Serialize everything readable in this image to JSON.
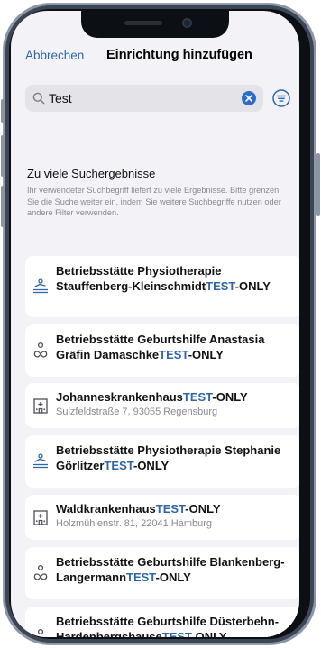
{
  "nav": {
    "cancel_label": "Abbrechen",
    "title": "Einrichtung hinzufügen"
  },
  "search": {
    "value": "Test"
  },
  "message": {
    "title": "Zu viele Suchergebnisse",
    "body": "Ihr verwendeter Suchbegriff liefert zu viele Ergebnisse. Bitte grenzen Sie die Suche weiter ein, indem Sie weitere Suchbegriffe nutzen oder andere Filter verwenden."
  },
  "results": [
    {
      "icon": "physiotherapy-icon",
      "name": "Betriebsstätte Physiotherapie Stauffenberg-Kleinschmidt",
      "highlight": "TEST",
      "suffix": "-ONLY",
      "address": ""
    },
    {
      "icon": "midwifery-icon",
      "name": "Betriebsstätte Geburtshilfe Anastasia Gräfin Damaschke",
      "highlight": "TEST",
      "suffix": "-ONLY",
      "address": ""
    },
    {
      "icon": "hospital-icon",
      "name": "Johanneskrankenhaus",
      "highlight": "TEST",
      "suffix": "-ONLY",
      "address": "Sulzfeldstraße 7, 93055 Regensburg"
    },
    {
      "icon": "physiotherapy-icon",
      "name": "Betriebsstätte Physiotherapie Stephanie Görlitzer",
      "highlight": "TEST",
      "suffix": "-ONLY",
      "address": ""
    },
    {
      "icon": "hospital-icon",
      "name": "Waldkrankenhaus",
      "highlight": "TEST",
      "suffix": "-ONLY",
      "address": "Holzmühlenstr. 81, 22041 Hamburg"
    },
    {
      "icon": "midwifery-icon",
      "name": "Betriebsstätte Geburtshilfe Blankenberg-Langermann",
      "highlight": "TEST",
      "suffix": "-ONLY",
      "address": ""
    },
    {
      "icon": "midwifery-icon",
      "name": "Betriebsstätte Geburtshilfe Düsterbehn-Hardenbergshause",
      "highlight": "TEST",
      "suffix": "-ONLY",
      "address": ""
    }
  ],
  "colors": {
    "accent": "#2f66a8",
    "clear_button": "#2e6cc7",
    "background": "#f2f2f7",
    "frame": "#3c4654"
  }
}
